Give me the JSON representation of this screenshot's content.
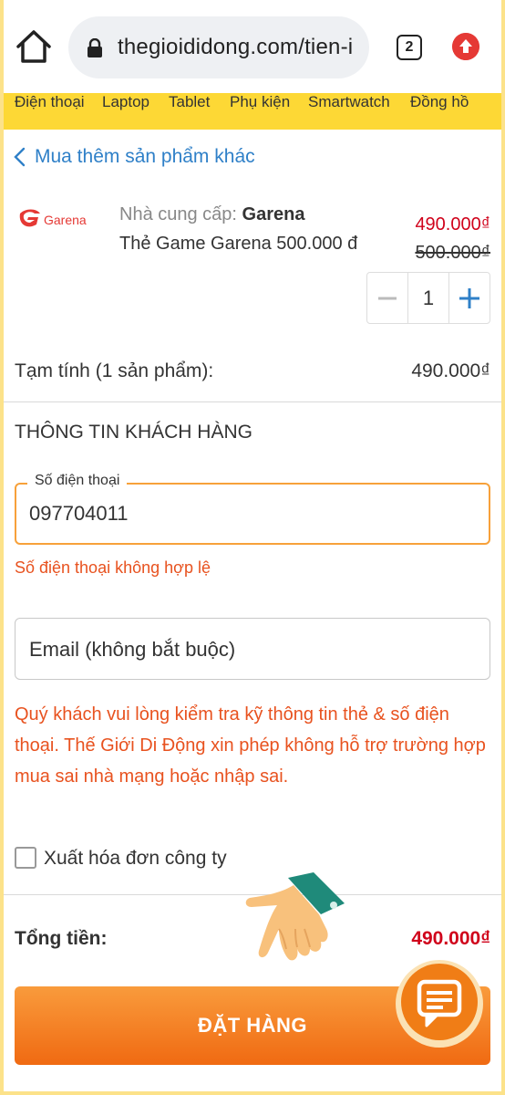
{
  "browser": {
    "url": "thegioididong.com/tien-i",
    "tab_count": "2"
  },
  "categories": [
    "Điện thoại",
    "Laptop",
    "Tablet",
    "Phụ kiện",
    "Smartwatch",
    "Đồng hồ"
  ],
  "back_link": "Mua thêm sản phẩm khác",
  "product": {
    "logo_text": "Garena",
    "provider_label": "Nhà cung cấp:",
    "provider_name": "Garena",
    "name": "Thẻ Game Garena 500.000 đ",
    "price_new": "490.000₫",
    "price_old": "500.000₫",
    "quantity": "1"
  },
  "subtotal": {
    "label": "Tạm tính (1 sản phẩm):",
    "value": "490.000₫"
  },
  "customer": {
    "section_title": "THÔNG TIN KHÁCH HÀNG",
    "phone_label": "Số điện thoại",
    "phone_value": "097704011",
    "phone_error": "Số điện thoại không hợp lệ",
    "email_placeholder": "Email (không bắt buộc)",
    "notice": "Quý khách vui lòng kiểm tra kỹ thông tin thẻ & số điện thoại. Thế Giới Di Động xin phép không hỗ trợ trường hợp mua sai nhà mạng hoặc nhập sai.",
    "invoice_label": "Xuất hóa đơn công ty"
  },
  "total": {
    "label": "Tổng tiền:",
    "value": "490.000₫"
  },
  "order_button": "ĐẶT HÀNG",
  "colors": {
    "accent": "#f7a13a",
    "price_red": "#d0021b",
    "link_blue": "#2f80c8",
    "nav_yellow": "#fdd835",
    "error_orange": "#e8521f"
  }
}
